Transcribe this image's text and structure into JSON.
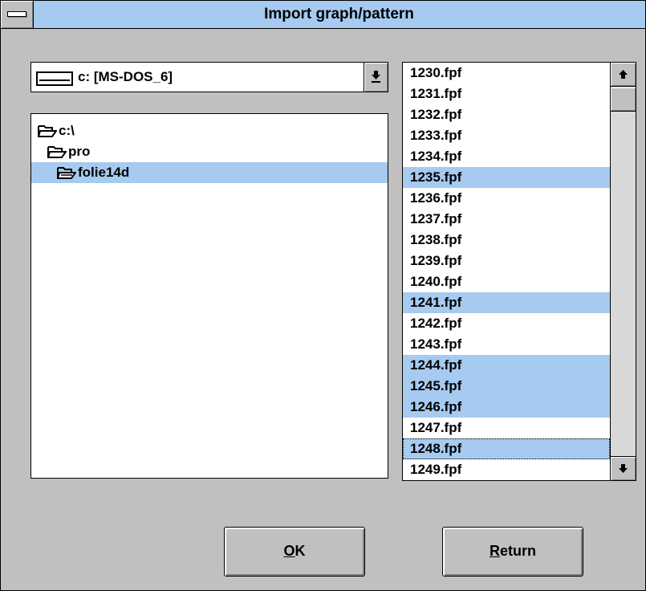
{
  "window": {
    "title": "Import graph/pattern"
  },
  "drive_select": {
    "value": "c: [MS-DOS_6]"
  },
  "directories": [
    {
      "label": "c:\\",
      "open": true,
      "selected": false,
      "indent": 0
    },
    {
      "label": "pro",
      "open": true,
      "selected": false,
      "indent": 1
    },
    {
      "label": "folie14d",
      "open": true,
      "selected": true,
      "indent": 2
    }
  ],
  "files": [
    {
      "name": "1230.fpf",
      "selected": false
    },
    {
      "name": "1231.fpf",
      "selected": false
    },
    {
      "name": "1232.fpf",
      "selected": false
    },
    {
      "name": "1233.fpf",
      "selected": false
    },
    {
      "name": "1234.fpf",
      "selected": false
    },
    {
      "name": "1235.fpf",
      "selected": true
    },
    {
      "name": "1236.fpf",
      "selected": false
    },
    {
      "name": "1237.fpf",
      "selected": false
    },
    {
      "name": "1238.fpf",
      "selected": false
    },
    {
      "name": "1239.fpf",
      "selected": false
    },
    {
      "name": "1240.fpf",
      "selected": false
    },
    {
      "name": "1241.fpf",
      "selected": true
    },
    {
      "name": "1242.fpf",
      "selected": false
    },
    {
      "name": "1243.fpf",
      "selected": false
    },
    {
      "name": "1244.fpf",
      "selected": true
    },
    {
      "name": "1245.fpf",
      "selected": true
    },
    {
      "name": "1246.fpf",
      "selected": true
    },
    {
      "name": "1247.fpf",
      "selected": false
    },
    {
      "name": "1248.fpf",
      "selected": true,
      "focused": true
    },
    {
      "name": "1249.fpf",
      "selected": false
    }
  ],
  "buttons": {
    "ok": {
      "mnemonic": "O",
      "rest": "K"
    },
    "return": {
      "mnemonic": "R",
      "rest": "eturn"
    }
  },
  "colors": {
    "title_bar": "#a6caf0",
    "selection": "#a6caf0",
    "face": "#c0c0c0"
  }
}
